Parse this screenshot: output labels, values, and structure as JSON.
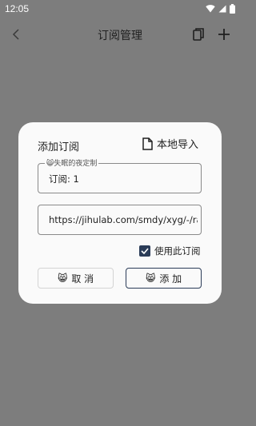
{
  "status_bar": {
    "time": "12:05"
  },
  "app_bar": {
    "title": "订阅管理"
  },
  "dialog": {
    "title": "添加订阅",
    "local_import_label": "本地导入",
    "name_field": {
      "legend_emoji": "😸",
      "legend": "失眠的夜定制",
      "value": "订阅: 1"
    },
    "url_field": {
      "value": "https://jihulab.com/smdy/xyg/-/raw"
    },
    "use_subscription": {
      "label": "使用此订阅",
      "checked": true
    },
    "cancel_button": {
      "emoji": "😸",
      "label": "取 消"
    },
    "add_button": {
      "emoji": "😸",
      "label": "添 加"
    }
  },
  "colors": {
    "background_dim": "#7d7d7d",
    "dialog_bg": "#fafafa",
    "accent": "#2b3c58"
  }
}
